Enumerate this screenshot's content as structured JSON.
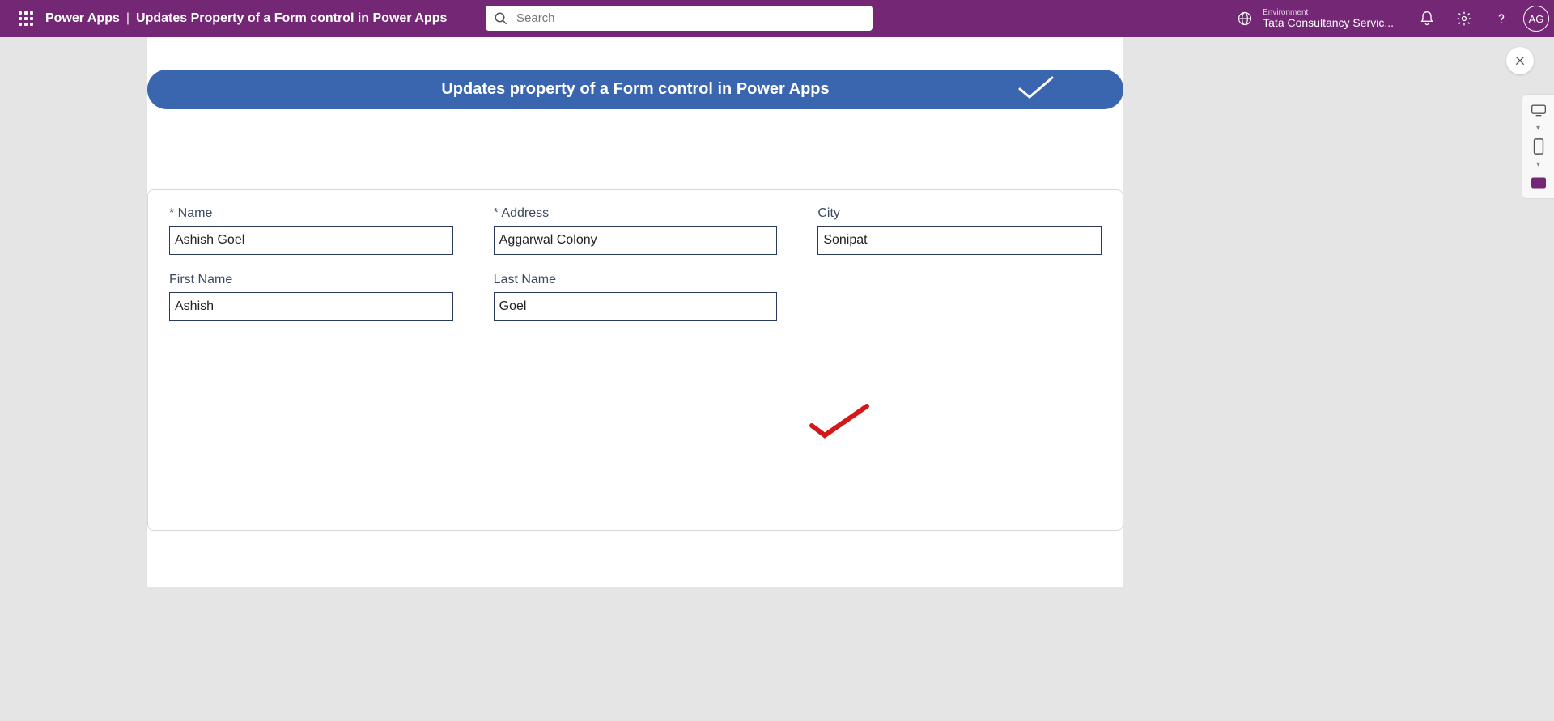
{
  "header": {
    "appName": "Power Apps",
    "separator": "|",
    "pageName": "Updates Property of a Form control in Power Apps",
    "searchPlaceholder": "Search",
    "environmentLabel": "Environment",
    "environmentName": "Tata Consultancy Servic...",
    "avatarInitials": "AG"
  },
  "banner": {
    "title": "Updates property of a Form control in Power Apps"
  },
  "form": {
    "fields": {
      "name": {
        "label": "* Name",
        "value": "Ashish Goel"
      },
      "address": {
        "label": "* Address",
        "value": "Aggarwal Colony"
      },
      "city": {
        "label": "City",
        "value": "Sonipat"
      },
      "firstName": {
        "label": "First Name",
        "value": "Ashish"
      },
      "lastName": {
        "label": "Last Name",
        "value": "Goel"
      }
    }
  }
}
